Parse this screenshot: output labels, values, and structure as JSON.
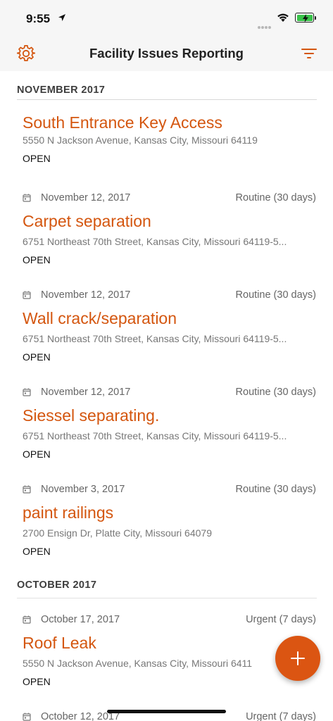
{
  "status_bar": {
    "time": "9:55"
  },
  "nav": {
    "title": "Facility Issues Reporting"
  },
  "sections": [
    {
      "header": "NOVEMBER 2017",
      "items": [
        {
          "date": "",
          "priority": "",
          "title": "South Entrance Key Access",
          "address": "5550 N Jackson Avenue, Kansas City, Missouri 64119",
          "status": "OPEN"
        },
        {
          "date": "November 12, 2017",
          "priority": "Routine (30 days)",
          "title": "Carpet separation",
          "address": "6751 Northeast 70th Street, Kansas City, Missouri 64119-5...",
          "status": "OPEN"
        },
        {
          "date": "November 12, 2017",
          "priority": "Routine (30 days)",
          "title": "Wall crack/separation",
          "address": "6751 Northeast 70th Street, Kansas City, Missouri 64119-5...",
          "status": "OPEN"
        },
        {
          "date": "November 12, 2017",
          "priority": "Routine (30 days)",
          "title": "Siessel separating.",
          "address": "6751 Northeast 70th Street, Kansas City, Missouri 64119-5...",
          "status": "OPEN"
        },
        {
          "date": "November 3, 2017",
          "priority": "Routine (30 days)",
          "title": "paint railings",
          "address": "2700 Ensign Dr, Platte City, Missouri 64079",
          "status": "OPEN"
        }
      ]
    },
    {
      "header": "OCTOBER 2017",
      "items": [
        {
          "date": "October 17, 2017",
          "priority": "Urgent (7 days)",
          "title": "Roof Leak",
          "address": "5550 N Jackson Avenue, Kansas City, Missouri 6411",
          "status": "OPEN"
        },
        {
          "date": "October 12, 2017",
          "priority": "Urgent (7 days)",
          "title": "",
          "address": "",
          "status": ""
        }
      ]
    }
  ],
  "colors": {
    "accent": "#d4560f",
    "fab": "#db5512",
    "header_bg": "#f6f6f6"
  },
  "icons": {
    "settings": "gear-icon",
    "filter": "filter-icon",
    "date": "calendar-icon",
    "add": "plus-icon"
  }
}
